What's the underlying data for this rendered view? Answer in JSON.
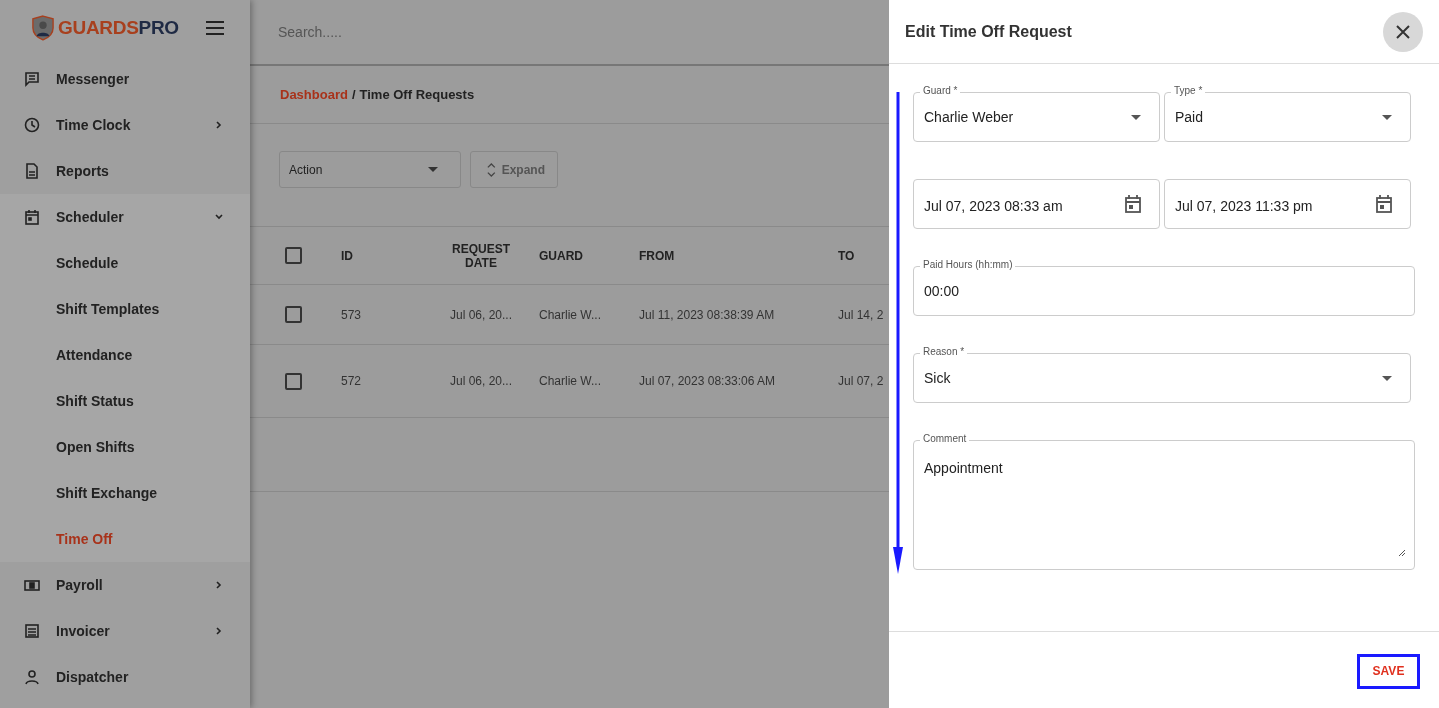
{
  "logo": {
    "part_1": "GUARDS",
    "part_2": "PRO"
  },
  "sidebar": {
    "items": [
      {
        "label": "Messenger",
        "submenu": false,
        "selected": false
      },
      {
        "label": "Time Clock",
        "submenu": true,
        "expanded": false,
        "selected": false
      },
      {
        "label": "Reports",
        "submenu": false,
        "selected": false
      },
      {
        "label": "Scheduler",
        "submenu": true,
        "expanded": true,
        "selected": false,
        "children": [
          {
            "label": "Schedule",
            "selected": false
          },
          {
            "label": "Shift Templates",
            "selected": false
          },
          {
            "label": "Attendance",
            "selected": false
          },
          {
            "label": "Shift Status",
            "selected": false
          },
          {
            "label": "Open Shifts",
            "selected": false
          },
          {
            "label": "Shift Exchange",
            "selected": false
          },
          {
            "label": "Time Off",
            "selected": true
          }
        ]
      },
      {
        "label": "Payroll",
        "submenu": true,
        "expanded": false,
        "selected": false
      },
      {
        "label": "Invoicer",
        "submenu": true,
        "expanded": false,
        "selected": false
      },
      {
        "label": "Dispatcher",
        "submenu": false,
        "selected": false
      }
    ]
  },
  "search": {
    "placeholder": "Search....."
  },
  "breadcrumb": {
    "link": "Dashboard",
    "separator": "/",
    "current": "Time Off Requests"
  },
  "toolbar": {
    "action": {
      "value": "Action"
    },
    "expand": {
      "label": "Expand"
    }
  },
  "table": {
    "select_all_checked": false,
    "columns": [
      "ID",
      "REQUEST DATE",
      "GUARD",
      "FROM",
      "TO"
    ],
    "rows": [
      {
        "checked": false,
        "cells": [
          "573",
          "Jul 06, 20...",
          "Charlie W...",
          "Jul 11, 2023 08:38:39 AM",
          "Jul 14, 2"
        ]
      },
      {
        "checked": false,
        "cells": [
          "572",
          "Jul 06, 20...",
          "Charlie W...",
          "Jul 07, 2023 08:33:06 AM",
          "Jul 07, 2"
        ]
      }
    ]
  },
  "drawer": {
    "title": "Edit Time Off Request",
    "rows": [
      {
        "fields": [
          {
            "kind": "select",
            "label": "Guard *",
            "value": "Charlie Weber"
          },
          {
            "kind": "select",
            "label": "Type *",
            "value": "Paid"
          }
        ]
      },
      {
        "fields": [
          {
            "kind": "date",
            "value": "Jul 07, 2023 08:33 am"
          },
          {
            "kind": "date",
            "value": "Jul 07, 2023 11:33 pm"
          }
        ]
      },
      {
        "fields": [
          {
            "kind": "text",
            "label": "Paid Hours (hh:mm)",
            "value": "00:00"
          }
        ]
      },
      {
        "fields": [
          {
            "kind": "select",
            "label": "Reason *",
            "value": "Sick"
          }
        ]
      },
      {
        "fields": [
          {
            "kind": "textarea",
            "label": "Comment",
            "value": "Appointment"
          }
        ]
      }
    ],
    "save": "SAVE"
  }
}
